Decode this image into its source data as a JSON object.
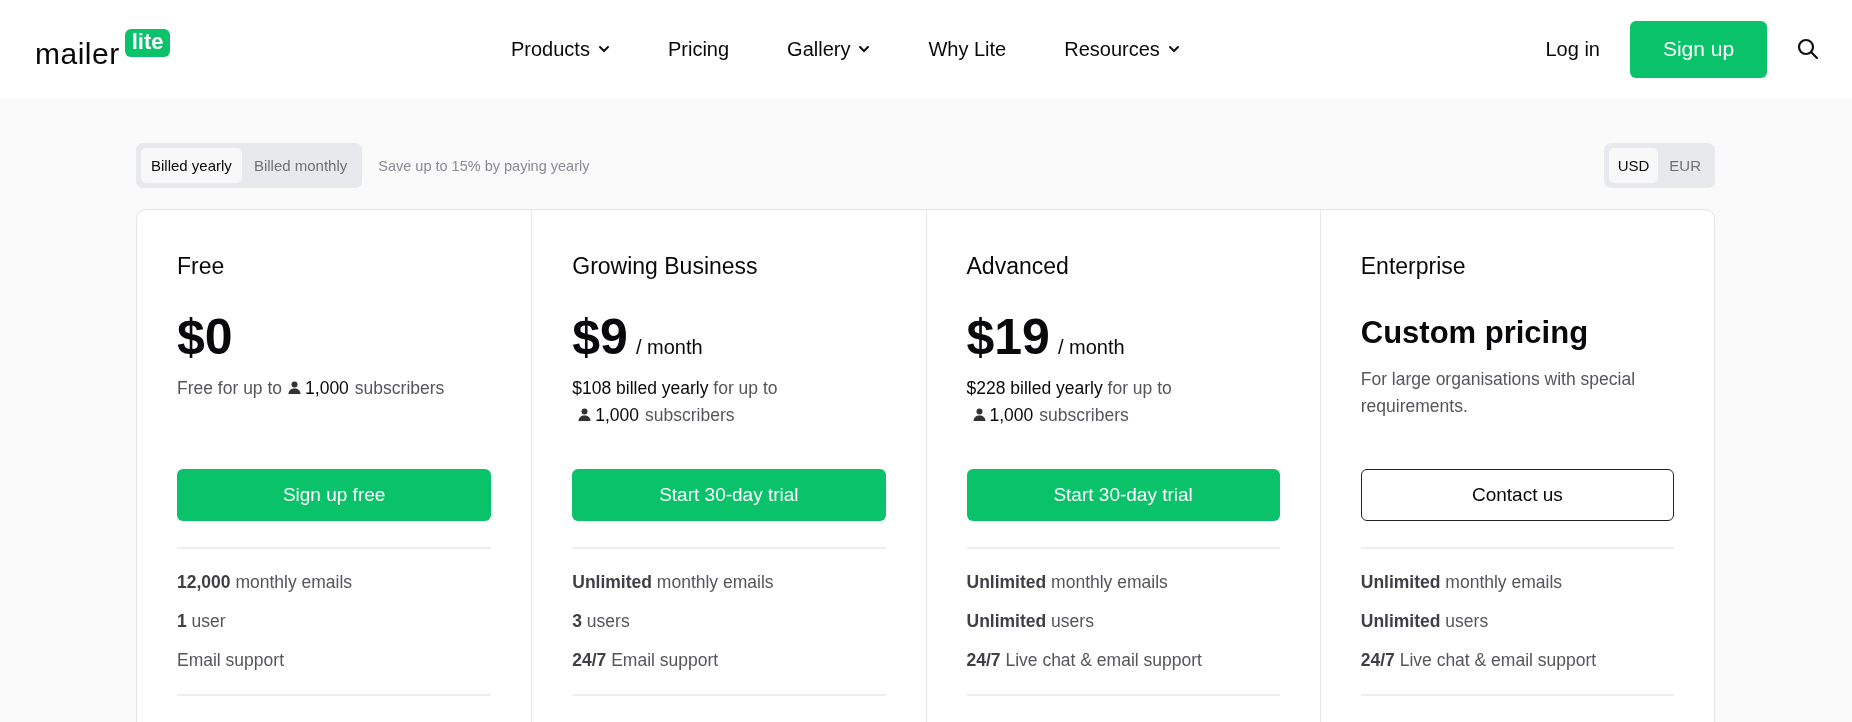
{
  "header": {
    "logo": {
      "word": "mailer",
      "badge": "lite"
    },
    "nav": [
      {
        "label": "Products",
        "dropdown": true
      },
      {
        "label": "Pricing",
        "dropdown": false
      },
      {
        "label": "Gallery",
        "dropdown": true
      },
      {
        "label": "Why Lite",
        "dropdown": false
      },
      {
        "label": "Resources",
        "dropdown": true
      }
    ],
    "login": "Log in",
    "signup": "Sign up"
  },
  "billing": {
    "options": [
      {
        "label": "Billed yearly",
        "selected": true
      },
      {
        "label": "Billed monthly",
        "selected": false
      }
    ],
    "note": "Save up to 15% by paying yearly"
  },
  "currency": [
    {
      "label": "USD",
      "selected": true
    },
    {
      "label": "EUR",
      "selected": false
    }
  ],
  "plans": [
    {
      "name": "Free",
      "kind": "amount",
      "price": "$0",
      "note": "Free for up to",
      "subscribers": "1,000",
      "subscribers_label": "subscribers",
      "cta": {
        "label": "Sign up free",
        "kind": "primary"
      },
      "features": [
        "**12,000** monthly emails",
        "**1** user",
        "Email support"
      ]
    },
    {
      "name": "Growing Business",
      "kind": "amount",
      "price": "$9",
      "period": "/ month",
      "note": "**$108 billed yearly** for up to",
      "subscribers": "1,000",
      "subscribers_label": "subscribers",
      "cta": {
        "label": "Start 30-day trial",
        "kind": "primary"
      },
      "features": [
        "**Unlimited** monthly emails",
        "**3** users",
        "**24/7** Email support"
      ]
    },
    {
      "name": "Advanced",
      "kind": "amount",
      "price": "$19",
      "period": "/ month",
      "note": "**$228 billed yearly** for up to",
      "subscribers": "1,000",
      "subscribers_label": "subscribers",
      "cta": {
        "label": "Start 30-day trial",
        "kind": "primary"
      },
      "features": [
        "**Unlimited** monthly emails",
        "**Unlimited** users",
        "**24/7** Live chat & email support"
      ]
    },
    {
      "name": "Enterprise",
      "kind": "custom",
      "price": "Custom pricing",
      "note": "For large organisations with special requirements.",
      "cta": {
        "label": "Contact us",
        "kind": "outline"
      },
      "features": [
        "**Unlimited** monthly emails",
        "**Unlimited** users",
        "**24/7** Live chat & email support"
      ]
    }
  ]
}
